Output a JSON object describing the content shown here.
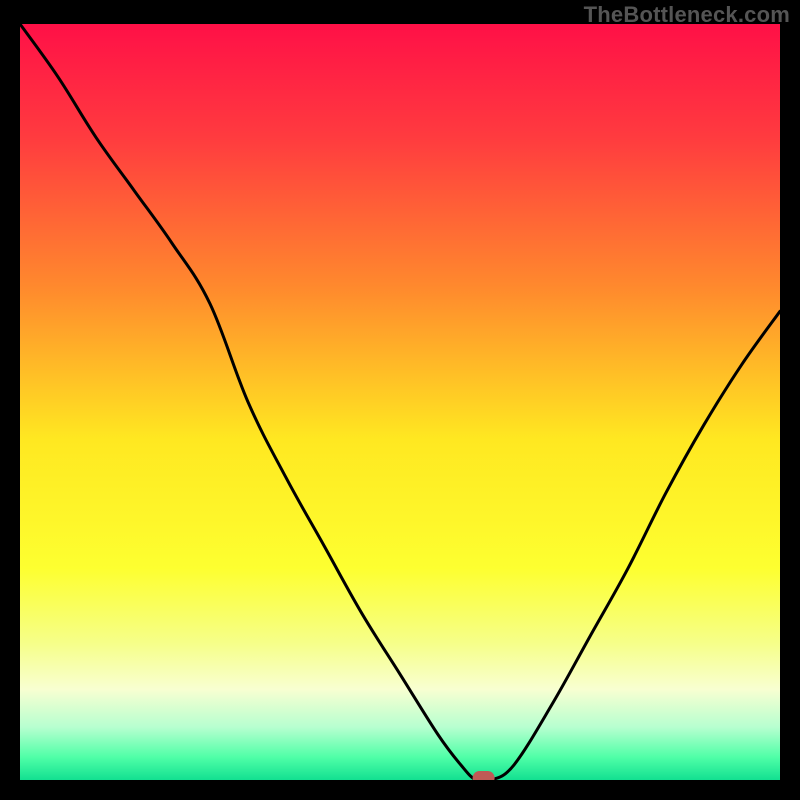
{
  "watermark": "TheBottleneck.com",
  "chart_data": {
    "type": "line",
    "title": "",
    "xlabel": "",
    "ylabel": "",
    "xlim": [
      0,
      100
    ],
    "ylim": [
      0,
      100
    ],
    "x": [
      0,
      5,
      10,
      15,
      20,
      25,
      30,
      35,
      40,
      45,
      50,
      55,
      58,
      60,
      62,
      65,
      70,
      75,
      80,
      85,
      90,
      95,
      100
    ],
    "values": [
      100,
      93,
      85,
      78,
      71,
      63,
      50,
      40,
      31,
      22,
      14,
      6,
      2,
      0,
      0,
      2,
      10,
      19,
      28,
      38,
      47,
      55,
      62
    ],
    "marker": {
      "x": 61,
      "y": 0
    },
    "background_gradient": {
      "stops": [
        {
          "offset": 0.0,
          "color": "#ff1047"
        },
        {
          "offset": 0.15,
          "color": "#ff3b3f"
        },
        {
          "offset": 0.35,
          "color": "#ff8a2d"
        },
        {
          "offset": 0.55,
          "color": "#ffe821"
        },
        {
          "offset": 0.72,
          "color": "#fdff30"
        },
        {
          "offset": 0.82,
          "color": "#f6ff8a"
        },
        {
          "offset": 0.88,
          "color": "#f8ffd1"
        },
        {
          "offset": 0.93,
          "color": "#b7ffd0"
        },
        {
          "offset": 0.97,
          "color": "#4fffa7"
        },
        {
          "offset": 1.0,
          "color": "#12e091"
        }
      ]
    }
  }
}
